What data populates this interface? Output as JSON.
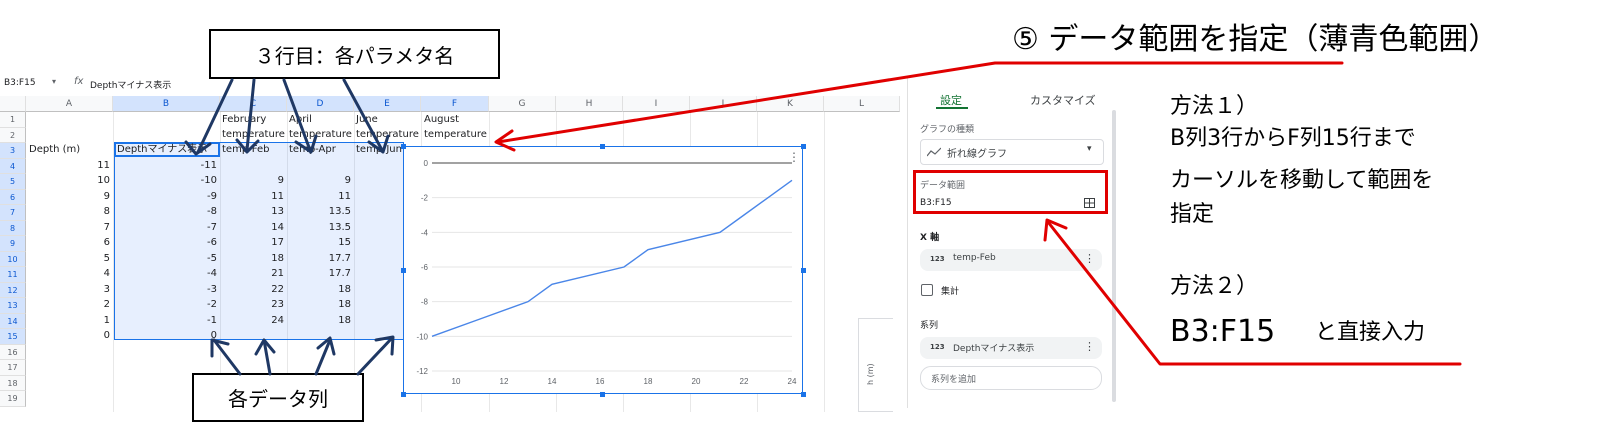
{
  "formula_bar": {
    "namebox": "B3:F15",
    "fx": "fx",
    "content": "Depthマイナス表示"
  },
  "columns": [
    "A",
    "B",
    "C",
    "D",
    "E",
    "F",
    "G",
    "H",
    "I",
    "J",
    "K",
    "L"
  ],
  "rows": [
    "1",
    "2",
    "3",
    "4",
    "5",
    "6",
    "7",
    "8",
    "9",
    "10",
    "11",
    "12",
    "13",
    "14",
    "15",
    "16",
    "17",
    "18",
    "19"
  ],
  "header_row1": {
    "c": "February",
    "d": "April",
    "e": "June",
    "f": "August"
  },
  "header_row2": {
    "c": "temperature",
    "d": "temperature",
    "e": "temperature",
    "f": "temperature"
  },
  "header_row3": {
    "a": "Depth (m)",
    "b": "Depthマイナス表示",
    "c": "temp-Feb",
    "d": "temp-Apr",
    "e": "temp-Jun"
  },
  "col_a": [
    "11",
    "10",
    "9",
    "8",
    "7",
    "6",
    "5",
    "4",
    "3",
    "2",
    "1",
    "0"
  ],
  "col_b": [
    "-11",
    "-10",
    "-9",
    "-8",
    "-7",
    "-6",
    "-5",
    "-4",
    "-3",
    "-2",
    "-1",
    "0"
  ],
  "col_c": [
    "",
    "9",
    "11",
    "13",
    "14",
    "17",
    "18",
    "21",
    "22",
    "23",
    "24",
    ""
  ],
  "col_d": [
    "",
    "9",
    "11",
    "13.5",
    "13.5",
    "15",
    "17.7",
    "17.7",
    "18",
    "18",
    "18",
    ""
  ],
  "chart_data": {
    "type": "line",
    "x": [
      9,
      11,
      13,
      14,
      17,
      18,
      21,
      22,
      23,
      24
    ],
    "series": [
      {
        "values": [
          -10,
          -9,
          -8,
          -7,
          -6,
          -5,
          -4,
          -3,
          -2,
          -1
        ],
        "color": "#4a86e8"
      }
    ],
    "xlim": [
      9,
      24
    ],
    "ylim": [
      -12,
      0
    ],
    "xticks": [
      "10",
      "12",
      "14",
      "16",
      "18",
      "20",
      "22",
      "24"
    ],
    "yticks": [
      "0",
      "-2",
      "-4",
      "-6",
      "-8",
      "-10",
      "-12"
    ],
    "grid": true
  },
  "side_panel": {
    "tab_settings": "設定",
    "tab_customize": "カスタマイズ",
    "chart_type_label": "グラフの種類",
    "chart_type_value": "折れ線グラフ",
    "data_range_label": "データ範囲",
    "data_range_value": "B3:F15",
    "x_axis_label": "X 軸",
    "x_axis_value": "temp-Feb",
    "aggregate_label": "集計",
    "series_label": "系列",
    "series_value": "Depthマイナス表示",
    "add_series": "系列を追加",
    "badge": "123"
  },
  "stub_label": "h (m)",
  "annotations": {
    "title": "⑤ データ範囲を指定（薄青色範囲）",
    "box_row3": "３行目：各パラメタ名",
    "box_cols": "各データ列",
    "method1_head": "方法１）",
    "method1_line1": "B列3行からF列15行まで",
    "method1_line2": "カーソルを移動して範囲を",
    "method1_line3": "指定",
    "method2_head": "方法２）",
    "method2_range": "B3:F15",
    "method2_text": "と直接入力"
  },
  "colors": {
    "accent": "#1a73e8",
    "selection": "#d3e3fd",
    "annotation_red": "#e00000",
    "tab_green": "#137333"
  }
}
